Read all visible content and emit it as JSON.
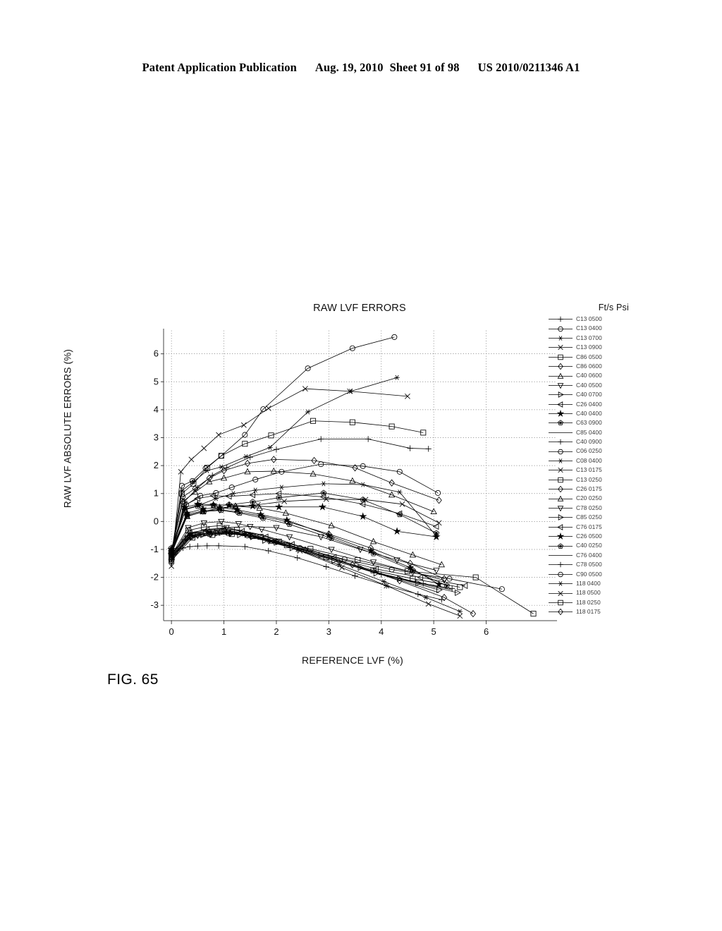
{
  "header": {
    "publication": "Patent Application Publication",
    "date": "Aug. 19, 2010",
    "sheet": "Sheet 91 of 98",
    "patent_number": "US 2010/0211346 A1"
  },
  "figure": {
    "caption": "FIG. 65"
  },
  "chart_data": {
    "type": "line",
    "title": "RAW LVF ERRORS",
    "xlabel": "REFERENCE LVF (%)",
    "ylabel": "RAW LVF ABSOLUTE ERRORS (%)",
    "xlim": [
      -0.15,
      7.35
    ],
    "ylim": [
      -3.55,
      6.9
    ],
    "xticks": [
      0,
      1,
      2,
      3,
      4,
      5,
      6
    ],
    "yticks": [
      -3,
      -2,
      -1,
      0,
      1,
      2,
      3,
      4,
      5,
      6
    ],
    "grid": true,
    "legend_position": "right",
    "legend_title": "Ft/s Psi",
    "series": [
      {
        "name": "C13 0500",
        "marker": "plus",
        "x": [
          0.0,
          0.12,
          0.22,
          0.35,
          0.5,
          0.68,
          0.9,
          1.4,
          1.85,
          2.4,
          2.95,
          3.5,
          4.1,
          4.7,
          5.15
        ],
        "y": [
          -1.3,
          -1.05,
          -0.95,
          -0.9,
          -0.88,
          -0.87,
          -0.87,
          -0.9,
          -1.05,
          -1.3,
          -1.62,
          -1.95,
          -2.3,
          -2.6,
          -2.8
        ]
      },
      {
        "name": "C13 0400",
        "marker": "circle",
        "x": [
          0.0,
          0.2,
          0.4,
          0.65,
          0.95,
          1.4,
          1.75,
          2.6,
          3.45,
          4.25
        ],
        "y": [
          -1.15,
          1.28,
          1.45,
          1.9,
          2.35,
          3.1,
          4.02,
          5.48,
          6.2,
          6.6
        ]
      },
      {
        "name": "C13 0700",
        "marker": "asterisk",
        "x": [
          0.0,
          0.2,
          0.42,
          0.68,
          0.95,
          1.42,
          1.88,
          2.6,
          3.42,
          4.3
        ],
        "y": [
          -1.2,
          1.1,
          1.42,
          1.82,
          1.95,
          2.32,
          2.65,
          3.92,
          4.66,
          5.15
        ]
      },
      {
        "name": "C13 0900",
        "marker": "x",
        "x": [
          0.0,
          0.18,
          0.38,
          0.62,
          0.9,
          1.38,
          1.85,
          2.55,
          3.4,
          4.5
        ],
        "y": [
          -1.6,
          1.78,
          2.22,
          2.62,
          3.1,
          3.45,
          4.05,
          4.75,
          4.66,
          4.48
        ]
      },
      {
        "name": "C86 0500",
        "marker": "square",
        "x": [
          0.0,
          0.2,
          0.42,
          0.68,
          0.95,
          1.4,
          1.9,
          2.7,
          3.45,
          4.2,
          4.8
        ],
        "y": [
          -1.15,
          1.0,
          1.35,
          1.92,
          2.35,
          2.78,
          3.08,
          3.6,
          3.55,
          3.4,
          3.18
        ]
      },
      {
        "name": "C86 0600",
        "marker": "diamond",
        "x": [
          0.0,
          0.22,
          0.45,
          0.72,
          1.0,
          1.45,
          1.95,
          2.72,
          3.5,
          4.2,
          5.1
        ],
        "y": [
          -1.1,
          0.88,
          1.18,
          1.55,
          1.82,
          2.08,
          2.22,
          2.18,
          1.92,
          1.38,
          0.76
        ]
      },
      {
        "name": "C40 0600",
        "marker": "triangle-up",
        "x": [
          0.0,
          0.22,
          0.45,
          0.72,
          1.0,
          1.45,
          1.95,
          2.7,
          3.45,
          4.2,
          5.0
        ],
        "y": [
          -1.05,
          0.72,
          1.05,
          1.42,
          1.55,
          1.78,
          1.8,
          1.7,
          1.45,
          0.95,
          0.35
        ]
      },
      {
        "name": "C40 0500",
        "marker": "triangle-down",
        "x": [
          0.0,
          0.25,
          0.5,
          0.78,
          1.05,
          1.5,
          2.0,
          2.85,
          3.6,
          4.3,
          5.05
        ],
        "y": [
          -1.45,
          -0.72,
          -0.5,
          -0.35,
          -0.22,
          -0.18,
          -0.22,
          -0.55,
          -1.0,
          -1.38,
          -1.75
        ]
      },
      {
        "name": "C40 0700",
        "marker": "triangle-right",
        "x": [
          0.0,
          0.3,
          0.6,
          0.88,
          1.15,
          1.55,
          2.0,
          2.85,
          3.6,
          4.35,
          5.1
        ],
        "y": [
          -1.35,
          -0.6,
          -0.48,
          -0.42,
          -0.42,
          -0.55,
          -0.75,
          -1.2,
          -1.65,
          -2.05,
          -2.45
        ]
      },
      {
        "name": "C26 0400",
        "marker": "triangle-left",
        "x": [
          0.0,
          0.25,
          0.5,
          0.8,
          1.1,
          1.55,
          2.05,
          2.9,
          3.65,
          4.35,
          5.05
        ],
        "y": [
          -1.05,
          0.58,
          0.82,
          0.92,
          0.9,
          0.95,
          1.0,
          0.88,
          0.62,
          0.28,
          -0.18
        ]
      },
      {
        "name": "C40 0400",
        "marker": "star-filled",
        "x": [
          0.0,
          0.25,
          0.5,
          0.8,
          1.1,
          1.55,
          2.05,
          2.88,
          3.65,
          4.3,
          5.05
        ],
        "y": [
          -1.0,
          0.5,
          0.62,
          0.6,
          0.58,
          0.55,
          0.52,
          0.52,
          0.18,
          -0.35,
          -0.55
        ]
      },
      {
        "name": "C63 0900",
        "marker": "pentagon-filled",
        "x": [
          0.0,
          0.25,
          0.5,
          0.8,
          1.1,
          1.55,
          2.05,
          2.9,
          3.65,
          4.35,
          5.05
        ],
        "y": [
          -0.95,
          0.42,
          0.55,
          0.58,
          0.6,
          0.7,
          0.85,
          1.02,
          0.78,
          0.25,
          -0.42
        ]
      },
      {
        "name": "C85 0400",
        "marker": "none",
        "x": [
          0.0,
          0.3,
          0.6,
          0.9,
          1.2,
          1.65,
          2.15,
          3.0,
          3.75,
          4.45,
          5.1
        ],
        "y": [
          -1.2,
          -0.48,
          -0.3,
          -0.25,
          -0.28,
          -0.45,
          -0.7,
          -1.25,
          -1.75,
          -2.15,
          -2.55
        ]
      },
      {
        "name": "C40 0900",
        "marker": "plus",
        "x": [
          0.0,
          0.25,
          0.5,
          0.78,
          1.05,
          1.5,
          2.0,
          2.85,
          3.75,
          4.55,
          4.9
        ],
        "y": [
          -1.25,
          0.72,
          1.2,
          1.65,
          1.92,
          2.3,
          2.58,
          2.95,
          2.95,
          2.62,
          2.6
        ]
      },
      {
        "name": "C06 0250",
        "marker": "circle",
        "x": [
          0.0,
          0.28,
          0.55,
          0.85,
          1.15,
          1.6,
          2.1,
          2.85,
          3.65,
          4.35,
          5.08
        ],
        "y": [
          -1.1,
          0.6,
          0.92,
          1.02,
          1.22,
          1.5,
          1.78,
          2.05,
          1.98,
          1.78,
          1.02
        ]
      },
      {
        "name": "C08 0400",
        "marker": "asterisk",
        "x": [
          0.0,
          0.28,
          0.55,
          0.85,
          1.18,
          1.6,
          2.1,
          2.9,
          3.65,
          4.35,
          5.05
        ],
        "y": [
          -1.0,
          0.45,
          0.6,
          0.82,
          1.0,
          1.12,
          1.22,
          1.35,
          1.32,
          1.05,
          -0.52
        ]
      },
      {
        "name": "C13 0175",
        "marker": "x",
        "x": [
          0.0,
          0.3,
          0.6,
          0.9,
          1.2,
          1.65,
          2.15,
          2.95,
          3.7,
          4.4,
          5.1
        ],
        "y": [
          -1.15,
          0.2,
          0.35,
          0.48,
          0.52,
          0.6,
          0.72,
          0.8,
          0.78,
          0.62,
          -0.05
        ]
      },
      {
        "name": "C13 0250",
        "marker": "square",
        "x": [
          0.0,
          0.32,
          0.62,
          0.92,
          1.25,
          1.7,
          2.2,
          2.95,
          3.85,
          4.6,
          5.5
        ],
        "y": [
          -1.25,
          -0.32,
          -0.2,
          -0.15,
          -0.3,
          -0.55,
          -0.85,
          -1.28,
          -1.75,
          -2.05,
          -2.35
        ]
      },
      {
        "name": "C26 0175",
        "marker": "diamond",
        "x": [
          0.0,
          0.3,
          0.6,
          0.92,
          1.25,
          1.7,
          2.2,
          3.0,
          3.8,
          4.55,
          5.2
        ],
        "y": [
          -1.05,
          0.25,
          0.38,
          0.42,
          0.35,
          0.2,
          0.0,
          -0.45,
          -0.95,
          -1.5,
          -2.05
        ]
      },
      {
        "name": "C20 0250",
        "marker": "triangle-up",
        "x": [
          0.0,
          0.3,
          0.6,
          0.92,
          1.22,
          1.68,
          2.18,
          3.05,
          3.85,
          4.6,
          5.15
        ],
        "y": [
          -1.1,
          0.18,
          0.35,
          0.48,
          0.55,
          0.48,
          0.3,
          -0.15,
          -0.72,
          -1.2,
          -1.55
        ]
      },
      {
        "name": "C78 0250",
        "marker": "triangle-down",
        "x": [
          0.0,
          0.32,
          0.62,
          0.95,
          1.28,
          1.72,
          2.25,
          3.05,
          3.85,
          4.6,
          5.2
        ],
        "y": [
          -1.2,
          -0.22,
          -0.05,
          0.0,
          -0.08,
          -0.28,
          -0.55,
          -1.0,
          -1.45,
          -1.82,
          -2.1
        ]
      },
      {
        "name": "C85 0250",
        "marker": "triangle-right",
        "x": [
          0.0,
          0.35,
          0.65,
          0.95,
          1.3,
          1.78,
          2.3,
          3.1,
          3.9,
          4.7,
          5.45
        ],
        "y": [
          -1.3,
          -0.52,
          -0.42,
          -0.4,
          -0.48,
          -0.68,
          -0.95,
          -1.4,
          -1.85,
          -2.2,
          -2.55
        ]
      },
      {
        "name": "C76 0175",
        "marker": "triangle-left",
        "x": [
          0.0,
          0.35,
          0.68,
          1.0,
          1.35,
          1.8,
          2.3,
          3.1,
          3.9,
          4.75,
          5.6
        ],
        "y": [
          -1.15,
          -0.4,
          -0.3,
          -0.28,
          -0.35,
          -0.55,
          -0.82,
          -1.28,
          -1.7,
          -2.0,
          -2.3
        ]
      },
      {
        "name": "C26 0500",
        "marker": "star-filled",
        "x": [
          0.0,
          0.3,
          0.6,
          0.92,
          1.25,
          1.7,
          2.2,
          3.0,
          3.8,
          4.55,
          5.1
        ],
        "y": [
          -1.0,
          0.3,
          0.45,
          0.5,
          0.42,
          0.25,
          0.05,
          -0.5,
          -1.05,
          -1.65,
          -2.25
        ]
      },
      {
        "name": "C40 0250",
        "marker": "pentagon-filled",
        "x": [
          0.0,
          0.3,
          0.62,
          0.95,
          1.3,
          1.75,
          2.25,
          3.05,
          3.85,
          4.6,
          5.25
        ],
        "y": [
          -1.05,
          0.2,
          0.35,
          0.4,
          0.3,
          0.12,
          -0.1,
          -0.6,
          -1.15,
          -1.75,
          -2.3
        ]
      },
      {
        "name": "C76 0400",
        "marker": "none",
        "x": [
          0.0,
          0.35,
          0.68,
          1.0,
          1.35,
          1.8,
          2.35,
          3.15,
          3.95,
          4.75,
          5.35
        ],
        "y": [
          -1.25,
          -0.45,
          -0.35,
          -0.32,
          -0.4,
          -0.62,
          -0.9,
          -1.38,
          -1.85,
          -2.2,
          -2.45
        ]
      },
      {
        "name": "C78 0500",
        "marker": "plus",
        "x": [
          0.0,
          0.35,
          0.7,
          1.05,
          1.4,
          1.85,
          2.4,
          3.2,
          4.0,
          4.8,
          5.35
        ],
        "y": [
          -1.3,
          -0.5,
          -0.42,
          -0.4,
          -0.48,
          -0.7,
          -1.0,
          -1.45,
          -1.9,
          -2.22,
          -2.4
        ]
      },
      {
        "name": "C90 0500",
        "marker": "circle",
        "x": [
          0.0,
          0.38,
          0.72,
          1.08,
          1.45,
          1.9,
          2.45,
          3.3,
          4.2,
          5.3,
          6.3
        ],
        "y": [
          -1.35,
          -0.55,
          -0.45,
          -0.42,
          -0.5,
          -0.7,
          -0.95,
          -1.35,
          -1.72,
          -2.05,
          -2.42
        ]
      },
      {
        "name": "118 0400",
        "marker": "asterisk",
        "x": [
          0.0,
          0.35,
          0.68,
          1.02,
          1.38,
          1.85,
          2.4,
          3.2,
          4.05,
          4.85,
          5.5
        ],
        "y": [
          -1.2,
          -0.42,
          -0.35,
          -0.35,
          -0.45,
          -0.68,
          -1.0,
          -1.55,
          -2.15,
          -2.72,
          -3.22
        ]
      },
      {
        "name": "118 0500",
        "marker": "x",
        "x": [
          0.0,
          0.38,
          0.72,
          1.08,
          1.45,
          1.9,
          2.45,
          3.25,
          4.1,
          4.9,
          5.5
        ],
        "y": [
          -1.25,
          -0.48,
          -0.4,
          -0.38,
          -0.48,
          -0.72,
          -1.05,
          -1.65,
          -2.3,
          -2.95,
          -3.38
        ]
      },
      {
        "name": "118 0250",
        "marker": "square",
        "x": [
          0.0,
          0.4,
          0.78,
          1.15,
          1.55,
          2.05,
          2.65,
          3.55,
          4.5,
          5.8,
          6.9
        ],
        "y": [
          -1.4,
          -0.58,
          -0.48,
          -0.45,
          -0.52,
          -0.72,
          -0.98,
          -1.38,
          -1.78,
          -2.0,
          -3.3
        ]
      },
      {
        "name": "118 0175",
        "marker": "diamond",
        "x": [
          0.0,
          0.38,
          0.75,
          1.12,
          1.5,
          2.0,
          2.55,
          3.45,
          4.35,
          5.2,
          5.75
        ],
        "y": [
          -1.3,
          -0.52,
          -0.45,
          -0.42,
          -0.5,
          -0.72,
          -1.02,
          -1.55,
          -2.12,
          -2.72,
          -3.3
        ]
      }
    ]
  }
}
